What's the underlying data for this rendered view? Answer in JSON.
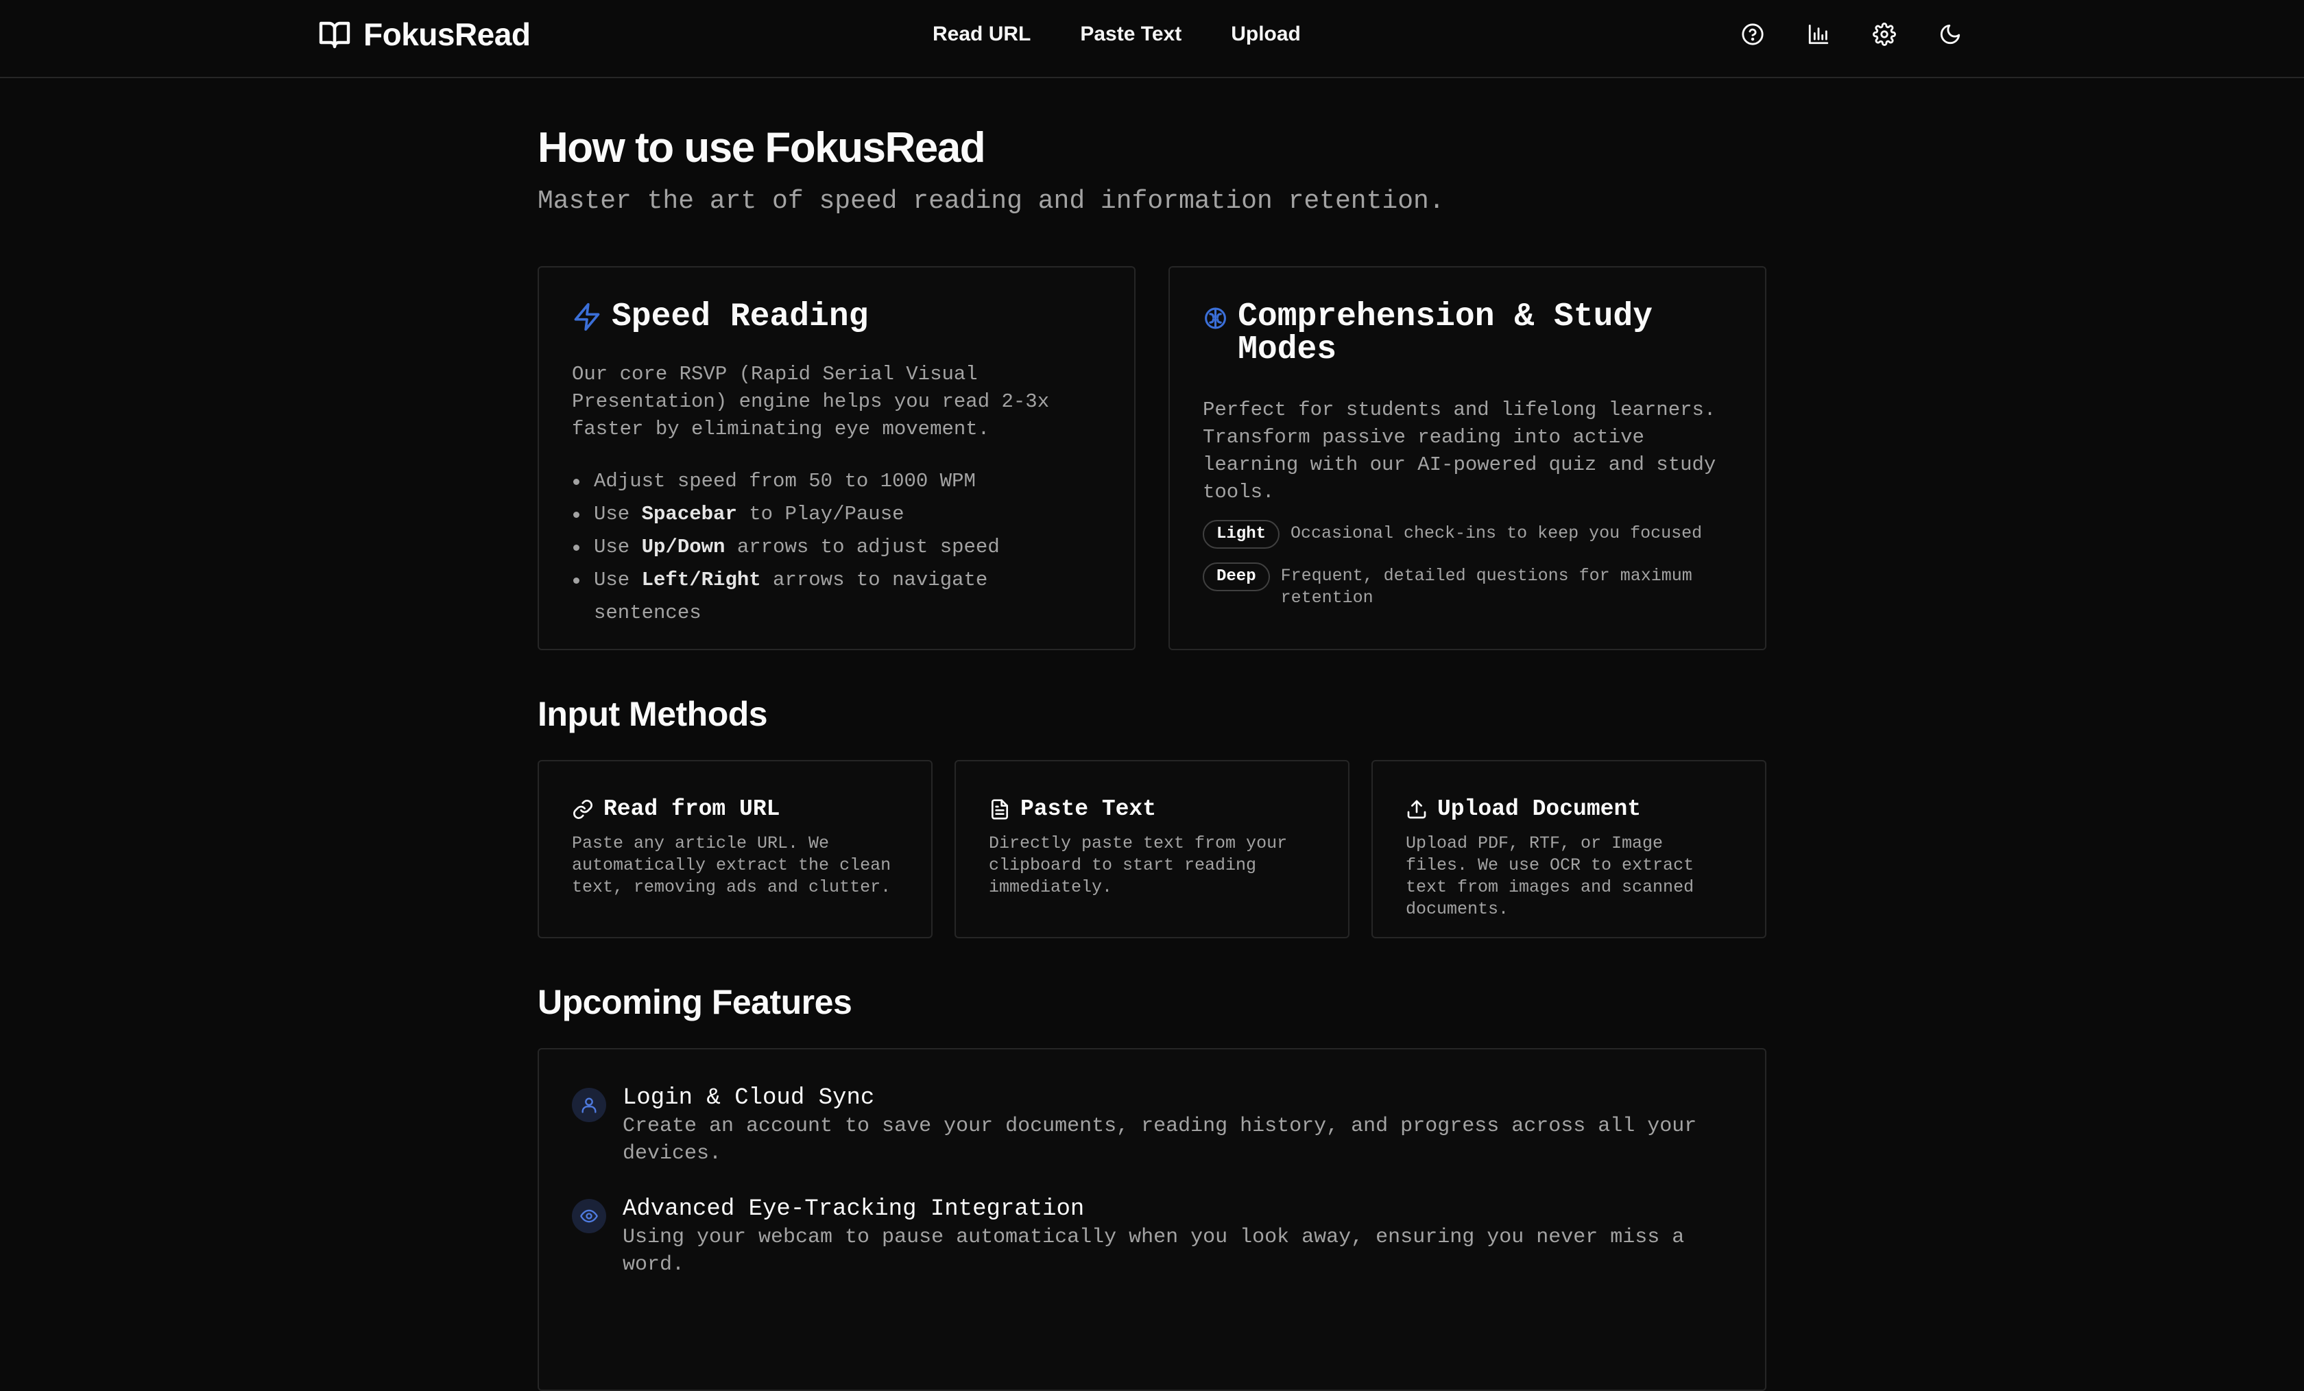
{
  "header": {
    "brand": "FokusRead",
    "nav": [
      "Read URL",
      "Paste Text",
      "Upload"
    ],
    "icons": [
      "help-circle-icon",
      "bar-chart-icon",
      "settings-icon",
      "moon-icon"
    ]
  },
  "page": {
    "title": "How to use FokusRead",
    "subtitle": "Master the art of speed reading and information retention."
  },
  "speed": {
    "title": "Speed Reading",
    "desc": "Our core RSVP (Rapid Serial Visual Presentation) engine helps you read 2-3x faster by eliminating eye movement.",
    "items": [
      {
        "pre": "Adjust speed from 50 to 1000 WPM",
        "key": "",
        "post": ""
      },
      {
        "pre": "Use ",
        "key": "Spacebar",
        "post": " to Play/Pause"
      },
      {
        "pre": "Use ",
        "key": "Up/Down",
        "post": " arrows to adjust speed"
      },
      {
        "pre": "Use ",
        "key": "Left/Right",
        "post": " arrows to navigate sentences"
      }
    ]
  },
  "study": {
    "title": "Comprehension & Study Modes",
    "desc": "Perfect for students and lifelong learners. Transform passive reading into active learning with our AI-powered quiz and study tools.",
    "modes": [
      {
        "badge": "Light",
        "desc": "Occasional check-ins to keep you focused"
      },
      {
        "badge": "Deep",
        "desc": "Frequent, detailed questions for maximum retention"
      }
    ]
  },
  "input_methods": {
    "title": "Input Methods",
    "cards": [
      {
        "title": "Read from URL",
        "desc": "Paste any article URL. We automatically extract the clean text, removing ads and clutter."
      },
      {
        "title": "Paste Text",
        "desc": "Directly paste text from your clipboard to start reading immediately."
      },
      {
        "title": "Upload Document",
        "desc": "Upload PDF, RTF, or Image files. We use OCR to extract text from images and scanned documents."
      }
    ]
  },
  "upcoming": {
    "title": "Upcoming Features",
    "items": [
      {
        "title": "Login & Cloud Sync",
        "desc": "Create an account to save your documents, reading history, and progress across all your devices."
      },
      {
        "title": "Advanced Eye-Tracking Integration",
        "desc": "Using your webcam to pause automatically when you look away, ensuring you never miss a word."
      }
    ]
  },
  "colors": {
    "background": "#0a0a0a",
    "accent": "#3b6fd8",
    "border": "#262626",
    "muted_text": "#a3a3a3"
  }
}
